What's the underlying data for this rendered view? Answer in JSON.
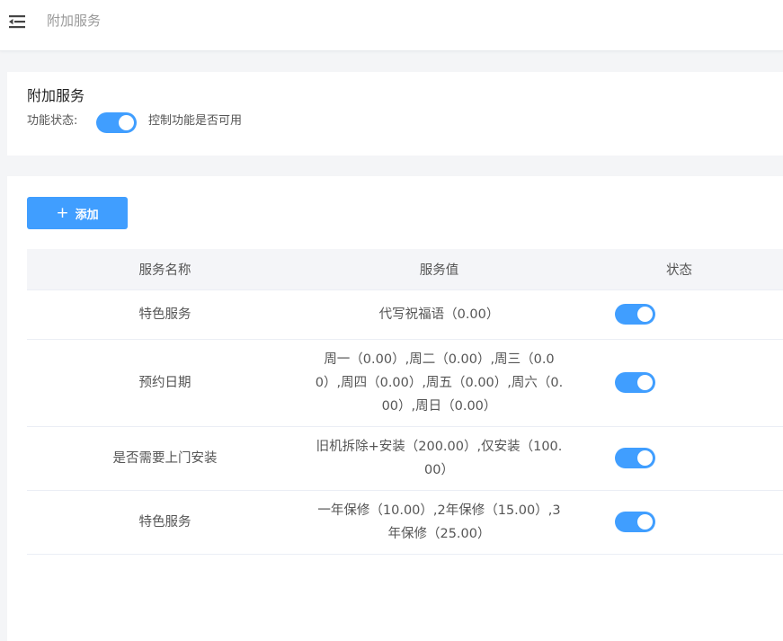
{
  "header": {
    "breadcrumb": "附加服务"
  },
  "feature": {
    "title": "附加服务",
    "status_label": "功能状态:",
    "status_enabled": true,
    "status_hint": "控制功能是否可用"
  },
  "toolbar": {
    "add_label": "添加"
  },
  "table": {
    "columns": [
      "服务名称",
      "服务值",
      "状态"
    ],
    "rows": [
      {
        "name": "特色服务",
        "value": "代写祝福语（0.00）",
        "enabled": true
      },
      {
        "name": "预约日期",
        "value": "周一（0.00）,周二（0.00）,周三（0.00）,周四（0.00）,周五（0.00）,周六（0.00）,周日（0.00）",
        "enabled": true
      },
      {
        "name": "是否需要上门安装",
        "value": "旧机拆除+安装（200.00）,仅安装（100.00）",
        "enabled": true
      },
      {
        "name": "特色服务",
        "value": "一年保修（10.00）,2年保修（15.00）,3年保修（25.00）",
        "enabled": true
      }
    ]
  },
  "colors": {
    "accent": "#409eff",
    "page_bg": "#f4f5f7",
    "header_cell_bg": "#f4f5f8"
  }
}
